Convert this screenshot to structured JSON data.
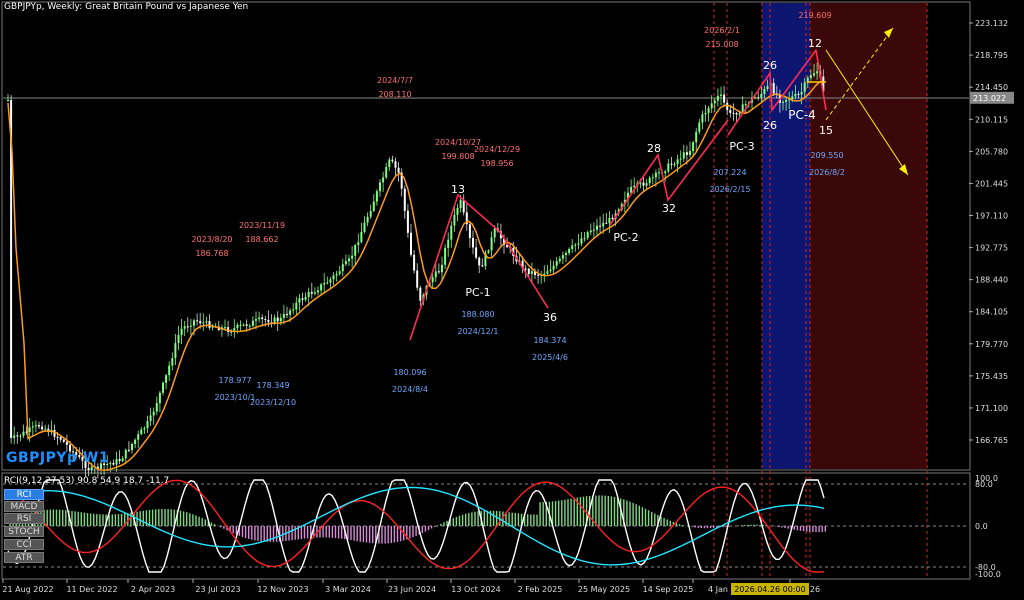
{
  "header": {
    "title": "GBPJPYp, Weekly:  Great Britain Pound vs Japanese Yen"
  },
  "symbol_label": "GBPJPYp W1",
  "indicator": {
    "title": "RCI(9,12,27,53) 90.8 54.9 18.7 -11.7",
    "buttons": [
      {
        "label": "RCI",
        "active": true
      },
      {
        "label": "MACD",
        "active": false
      },
      {
        "label": "RSI",
        "active": false
      },
      {
        "label": "STOCH",
        "active": false
      },
      {
        "label": "CCI",
        "active": false
      },
      {
        "label": "ATR",
        "active": false
      }
    ],
    "scale": [
      "100.0",
      "80.0",
      "0.0",
      "-80.0",
      "-100.0"
    ]
  },
  "price_scale": [
    "223.132",
    "218.795",
    "214.450",
    "210.115",
    "205.780",
    "201.445",
    "197.110",
    "192.775",
    "188.440",
    "184.105",
    "179.770",
    "175.435",
    "171.100",
    "166.765"
  ],
  "current_price": "213.022",
  "x_axis": [
    "21 Aug 2022",
    "11 Dec 2022",
    "2 Apr 2023",
    "23 Jul 2023",
    "12 Nov 2023",
    "3 Mar 2024",
    "23 Jun 2024",
    "13 Oct 2024",
    "2 Feb 2025",
    "25 May 2025",
    "14 Sep 2025",
    "4 Jan",
    "26"
  ],
  "cursor_date": "2026.04.26 00:00",
  "annotations": {
    "highs": [
      {
        "date": "2023/8/20",
        "price": "186.768"
      },
      {
        "date": "2023/11/19",
        "price": "188.662"
      },
      {
        "date": "2024/7/7",
        "price": "208.110"
      },
      {
        "date": "2024/10/27",
        "price": "199.808"
      },
      {
        "date": "2024/12/29",
        "price": "198.956"
      },
      {
        "date": "2026/2/1",
        "price": "215.008"
      },
      {
        "date": "",
        "price": "219.609"
      }
    ],
    "lows": [
      {
        "date": "2023/10/1",
        "price": "178.977"
      },
      {
        "date": "2023/12/10",
        "price": "178.349"
      },
      {
        "date": "2024/8/4",
        "price": "180.096"
      },
      {
        "date": "2024/12/1",
        "price": "188.080"
      },
      {
        "date": "2025/4/6",
        "price": "184.374"
      },
      {
        "date": "2026/2/15",
        "price": "207.224"
      },
      {
        "date": "2026/8/2",
        "price": "209.550"
      }
    ],
    "counts": [
      "13",
      "28",
      "32",
      "36",
      "26",
      "26",
      "12",
      "15"
    ],
    "pc_labels": [
      "PC-1",
      "PC-2",
      "PC-3",
      "PC-4"
    ]
  },
  "colors": {
    "bull": "#7fff7f",
    "bear": "#ffffff",
    "ma": "#ff9a1e",
    "zigzag": "#ff2a55",
    "high_label": "#ff6f6f",
    "low_label": "#6fa8ff",
    "blue_zone": "#0c1670",
    "red_zone": "#3a0808",
    "arrow": "#ffee00"
  }
}
